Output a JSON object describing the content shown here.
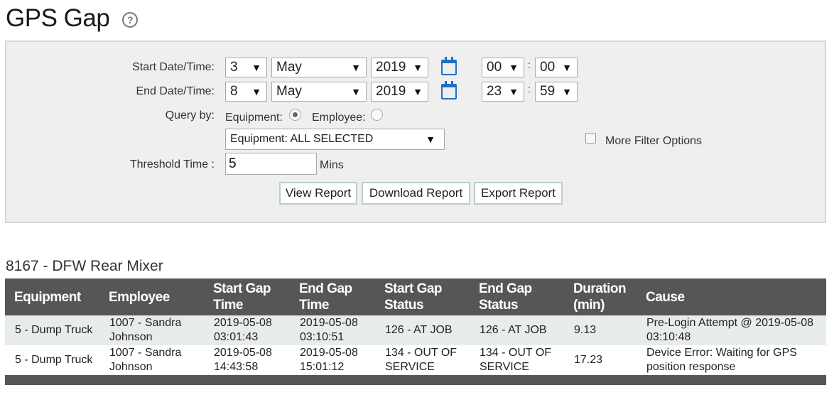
{
  "page": {
    "title": "GPS Gap"
  },
  "filters": {
    "start_label": "Start Date/Time:",
    "end_label": "End Date/Time:",
    "start": {
      "day": "3",
      "month": "May",
      "year": "2019",
      "hour": "00",
      "minute": "00"
    },
    "end": {
      "day": "8",
      "month": "May",
      "year": "2019",
      "hour": "23",
      "minute": "59"
    },
    "time_separator": ":",
    "query_label": "Query by:",
    "equipment_radio_label": "Equipment:",
    "employee_radio_label": "Employee:",
    "equipment_select": "Equipment: ALL SELECTED",
    "more_filter_label": "More Filter Options",
    "threshold_label": "Threshold Time :",
    "threshold_value": "5",
    "threshold_unit": "Mins",
    "view_button": "View Report",
    "download_button": "Download Report",
    "export_button": "Export Report"
  },
  "results": {
    "group_title": "8167 - DFW Rear Mixer",
    "columns": [
      "Equipment",
      "Employee",
      "Start Gap Time",
      "End Gap Time",
      "Start Gap Status",
      "End Gap Status",
      "Duration (min)",
      "Cause"
    ],
    "rows": [
      {
        "equipment": "5 - Dump Truck",
        "employee": "1007 - Sandra Johnson",
        "start_gap_time": "2019-05-08 03:01:43",
        "end_gap_time": "2019-05-08 03:10:51",
        "start_gap_status": "126 - AT JOB",
        "end_gap_status": "126 - AT JOB",
        "duration": "9.13",
        "cause": "Pre-Login Attempt @ 2019-05-08 03:10:48"
      },
      {
        "equipment": "5 - Dump Truck",
        "employee": "1007 - Sandra Johnson",
        "start_gap_time": "2019-05-08 14:43:58",
        "end_gap_time": "2019-05-08 15:01:12",
        "start_gap_status": "134 - OUT OF SERVICE",
        "end_gap_status": "134 - OUT OF SERVICE",
        "duration": "17.23",
        "cause": "Device Error: Waiting for GPS position response"
      }
    ]
  },
  "icons": {
    "help": "question-circle-icon",
    "calendar": "calendar-icon",
    "dropdown": "caret-down-icon"
  },
  "colors": {
    "header_bg": "#565656",
    "panel_bg": "#efefef",
    "accent": "#1e6fc6",
    "odd_row": "#e8ecec"
  }
}
